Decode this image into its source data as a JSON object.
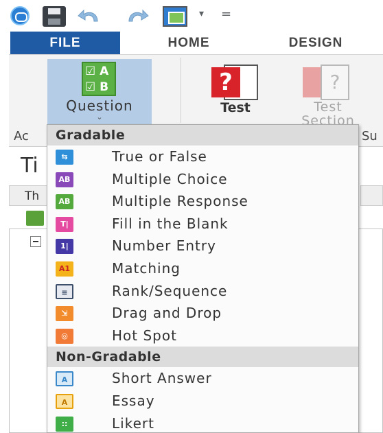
{
  "quick_access": {
    "icons": [
      "app-logo-icon",
      "save-icon",
      "undo-icon",
      "redo-icon",
      "quick-layout-icon",
      "dropdown-arrow-icon",
      "customize-icon"
    ],
    "dropdown_glyph": "▾",
    "customize_glyph": "="
  },
  "ribbon_tabs": [
    {
      "label": "FILE",
      "active": true
    },
    {
      "label": "HOME",
      "active": false
    },
    {
      "label": "DESIGN",
      "active": false
    }
  ],
  "ribbon": {
    "question_button": {
      "label": "Question",
      "caret": "⌄",
      "icon": "question-ab-icon"
    },
    "test_button": {
      "label": "Test",
      "icon": "test-icon"
    },
    "test_section_button": {
      "label": "Test\nSection",
      "icon": "test-section-icon",
      "disabled": true
    },
    "group_label_left": "Ac",
    "group_label_right": "Su"
  },
  "page": {
    "title_fragment": "Ti",
    "tree_tab_fragment": "Th"
  },
  "menu": {
    "sections": [
      {
        "header": "Gradable",
        "items": [
          {
            "label": "True or False",
            "icon": "true-false-icon"
          },
          {
            "label": "Multiple Choice",
            "icon": "multiple-choice-icon"
          },
          {
            "label": "Multiple Response",
            "icon": "multiple-response-icon"
          },
          {
            "label": "Fill in the Blank",
            "icon": "fill-in-blank-icon"
          },
          {
            "label": "Number Entry",
            "icon": "number-entry-icon"
          },
          {
            "label": "Matching",
            "icon": "matching-icon"
          },
          {
            "label": "Rank/Sequence",
            "icon": "rank-sequence-icon"
          },
          {
            "label": "Drag and Drop",
            "icon": "drag-drop-icon"
          },
          {
            "label": "Hot Spot",
            "icon": "hot-spot-icon"
          }
        ]
      },
      {
        "header": "Non-Gradable",
        "items": [
          {
            "label": "Short Answer",
            "icon": "short-answer-icon"
          },
          {
            "label": "Essay",
            "icon": "essay-icon"
          },
          {
            "label": "Likert",
            "icon": "likert-icon"
          }
        ]
      }
    ]
  },
  "colors": {
    "file_tab": "#1f5aa5",
    "question_highlight": "#b5cce6",
    "test_red": "#d8232a",
    "menu_header_bg": "#dcdcdc"
  }
}
